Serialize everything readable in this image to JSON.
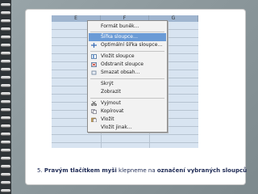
{
  "spreadsheet": {
    "column_headers": [
      "E",
      "F",
      "G"
    ]
  },
  "context_menu": {
    "items": [
      {
        "label": "Formát buněk…",
        "icon": "format-cells-icon",
        "highlighted": false
      },
      {
        "label": "Šířka sloupce…",
        "icon": "column-width-icon",
        "highlighted": true
      },
      {
        "label": "Optimální šířka sloupce…",
        "icon": "optimal-width-icon",
        "highlighted": false
      },
      {
        "label": "Vložit sloupce",
        "icon": "insert-columns-icon",
        "highlighted": false
      },
      {
        "label": "Odstranit sloupce",
        "icon": "delete-columns-icon",
        "highlighted": false
      },
      {
        "label": "Smazat obsah…",
        "icon": "clear-contents-icon",
        "highlighted": false
      },
      {
        "label": "Skrýt",
        "icon": "",
        "highlighted": false
      },
      {
        "label": "Zobrazit",
        "icon": "",
        "highlighted": false
      },
      {
        "label": "Vyjmout",
        "icon": "cut-icon",
        "highlighted": false
      },
      {
        "label": "Kopírovat",
        "icon": "copy-icon",
        "highlighted": false
      },
      {
        "label": "Vložit",
        "icon": "paste-icon",
        "highlighted": false
      },
      {
        "label": "Vložit jinak…",
        "icon": "",
        "highlighted": false
      }
    ]
  },
  "caption": {
    "number": "5. ",
    "part1": "Pravým tlačítkem myši",
    "part2": " klepneme na ",
    "part3": "označení vybraných sloupců"
  },
  "colors": {
    "highlight": "#6b9bd6",
    "selection": "#d8e4f1",
    "caption_text": "#1f2b55"
  }
}
